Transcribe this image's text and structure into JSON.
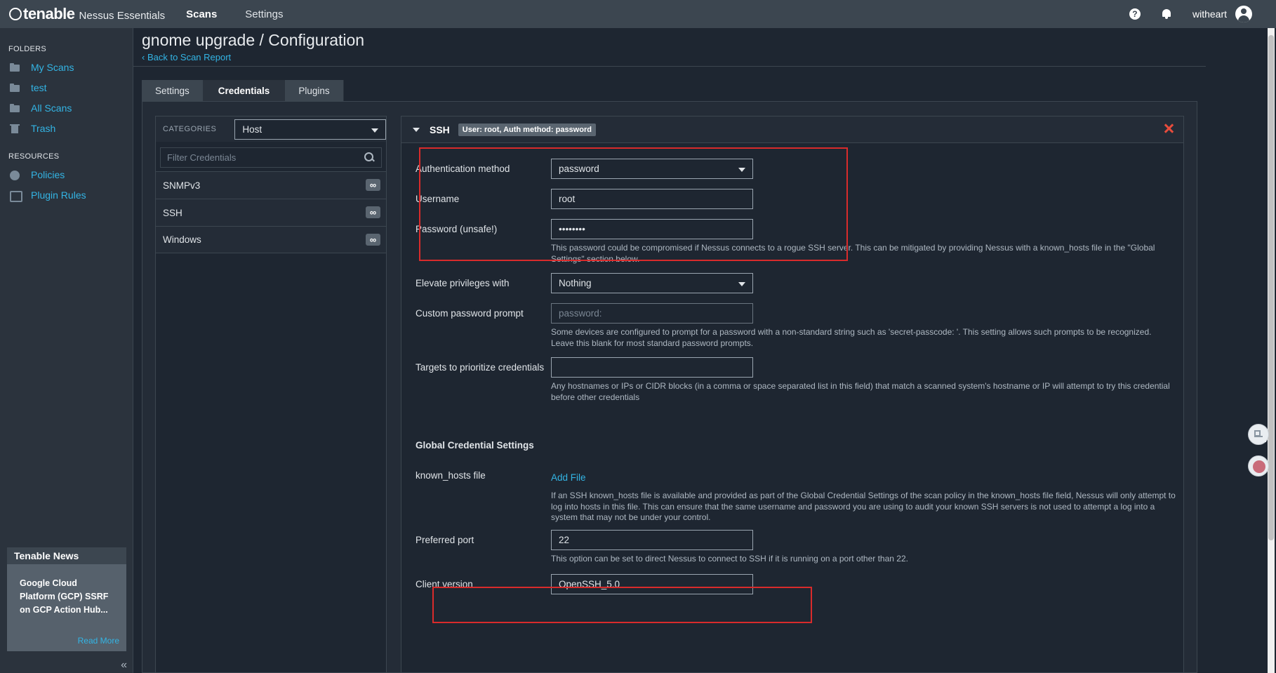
{
  "header": {
    "brand": "tenable",
    "product": "Nessus Essentials",
    "nav": [
      "Scans",
      "Settings"
    ],
    "help_icon": "question-icon",
    "username": "witheart"
  },
  "sidebar": {
    "folders_heading": "FOLDERS",
    "folders": [
      {
        "label": "My Scans",
        "icon": "folder-icon"
      },
      {
        "label": "test",
        "icon": "folder-icon"
      },
      {
        "label": "All Scans",
        "icon": "folder-icon"
      },
      {
        "label": "Trash",
        "icon": "trash-icon"
      }
    ],
    "resources_heading": "RESOURCES",
    "resources": [
      {
        "label": "Policies",
        "icon": "policy-icon"
      },
      {
        "label": "Plugin Rules",
        "icon": "rules-icon"
      }
    ],
    "news": {
      "title": "Tenable News",
      "body": "Google Cloud Platform (GCP) SSRF on GCP Action Hub...",
      "read_more": "Read More"
    },
    "collapse": "«"
  },
  "page": {
    "title": "gnome upgrade / Configuration",
    "back_link": "‹ Back to Scan Report",
    "tabs": [
      "Settings",
      "Credentials",
      "Plugins"
    ]
  },
  "credentials": {
    "categories_label": "CATEGORIES",
    "category_value": "Host",
    "filter_placeholder": "Filter Credentials",
    "items": [
      "SNMPv3",
      "SSH",
      "Windows"
    ],
    "badge": "∞"
  },
  "ssh": {
    "title": "SSH",
    "badge": "User: root, Auth method: password",
    "fields": {
      "auth_method": {
        "label": "Authentication method",
        "value": "password"
      },
      "username": {
        "label": "Username",
        "value": "root"
      },
      "password": {
        "label": "Password (unsafe!)",
        "value": "••••••••"
      },
      "password_help": "This password could be compromised if Nessus connects to a rogue SSH server. This can be mitigated by providing Nessus with a known_hosts file in the \"Global Settings\" section below.",
      "elevate": {
        "label": "Elevate privileges with",
        "value": "Nothing"
      },
      "custom_prompt": {
        "label": "Custom password prompt",
        "placeholder": "password:"
      },
      "custom_prompt_help": "Some devices are configured to prompt for a password with a non-standard string such as 'secret-passcode: '. This setting allows such prompts to be recognized. Leave this blank for most standard password prompts.",
      "targets": {
        "label": "Targets to prioritize credentials",
        "value": ""
      },
      "targets_help": "Any hostnames or IPs or CIDR blocks (in a comma or space separated list in this field) that match a scanned system's hostname or IP will attempt to try this credential before other credentials"
    },
    "global": {
      "title": "Global Credential Settings",
      "known_hosts": {
        "label": "known_hosts file",
        "action": "Add File"
      },
      "known_hosts_help": "If an SSH known_hosts file is available and provided as part of the Global Credential Settings of the scan policy in the known_hosts file field, Nessus will only attempt to log into hosts in this file. This can ensure that the same username and password you are using to audit your known SSH servers is not used to attempt a log into a system that may not be under your control.",
      "preferred_port": {
        "label": "Preferred port",
        "value": "22"
      },
      "preferred_port_help": "This option can be set to direct Nessus to connect to SSH if it is running on a port other than 22.",
      "client_version": {
        "label": "Client version",
        "value": "OpenSSH_5.0"
      }
    }
  },
  "colors": {
    "accent": "#33b5e5",
    "topbar": "#3c4650",
    "background": "#1e2631",
    "highlight_box": "#d92b2b"
  }
}
